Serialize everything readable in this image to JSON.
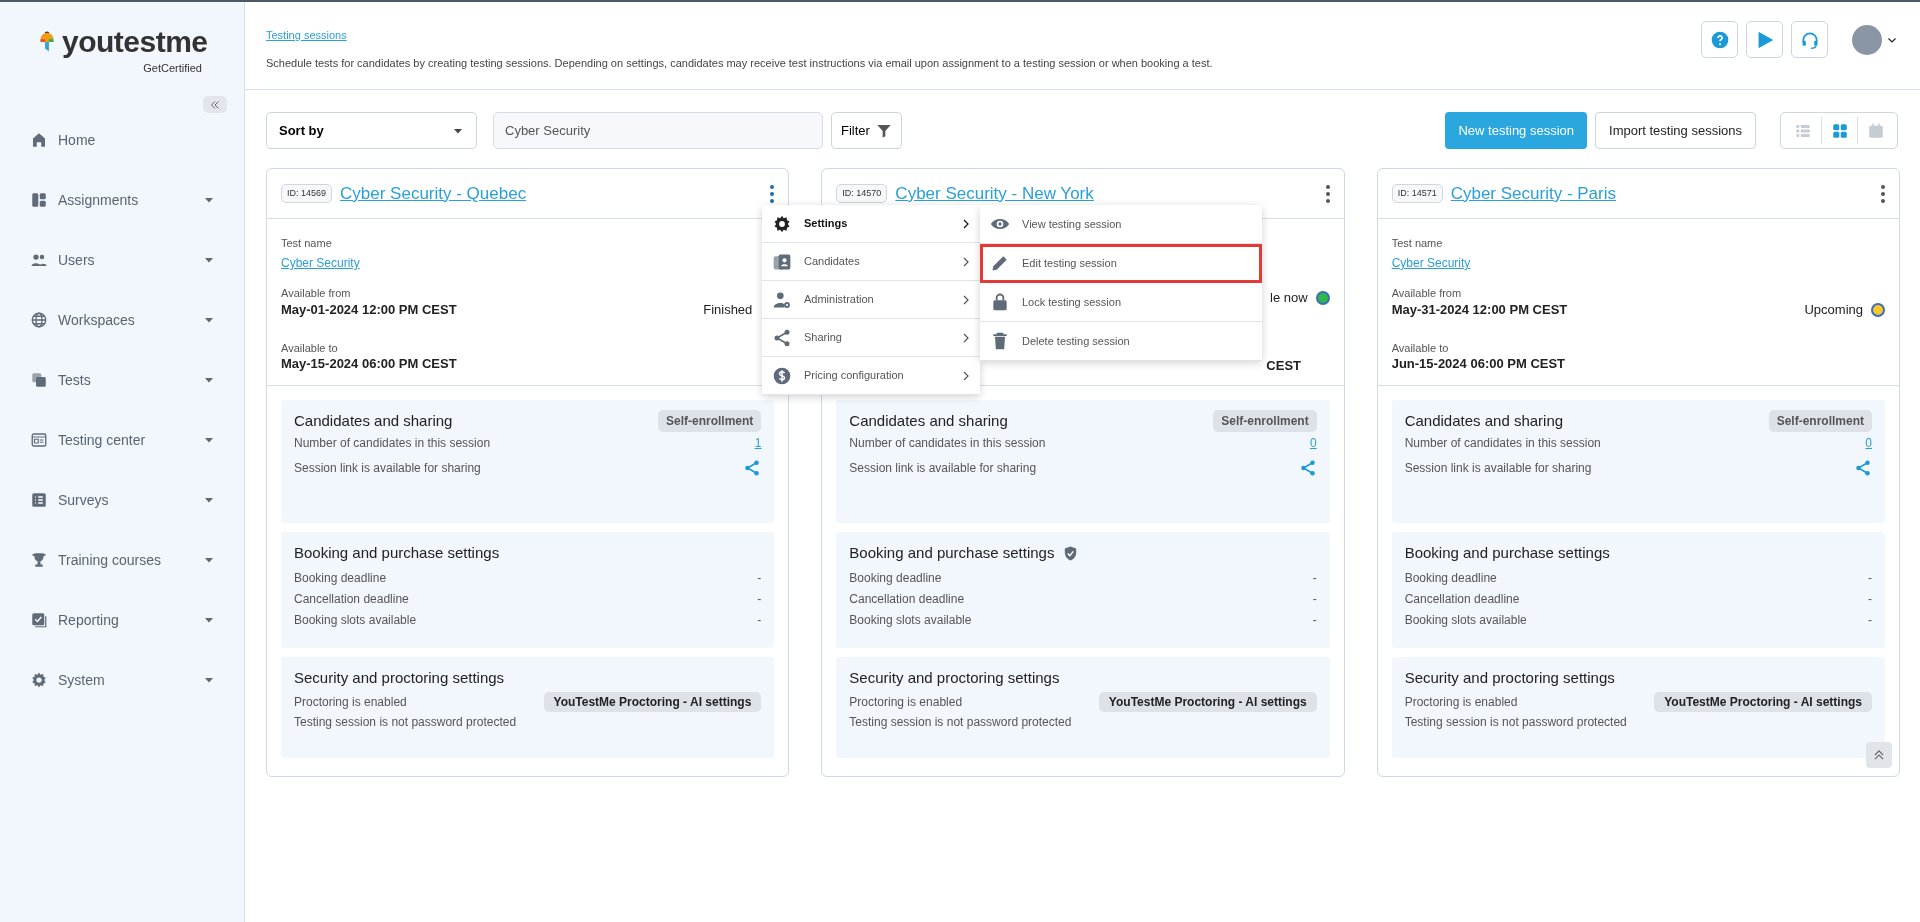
{
  "sidebar": {
    "logo": {
      "name": "youtestme",
      "tagline": "GetCertified"
    },
    "items": [
      {
        "label": "Home",
        "has_submenu": false
      },
      {
        "label": "Assignments",
        "has_submenu": true
      },
      {
        "label": "Users",
        "has_submenu": true
      },
      {
        "label": "Workspaces",
        "has_submenu": true
      },
      {
        "label": "Tests",
        "has_submenu": true
      },
      {
        "label": "Testing center",
        "has_submenu": true
      },
      {
        "label": "Surveys",
        "has_submenu": true
      },
      {
        "label": "Training courses",
        "has_submenu": true
      },
      {
        "label": "Reporting",
        "has_submenu": true
      },
      {
        "label": "System",
        "has_submenu": true
      }
    ]
  },
  "header": {
    "breadcrumb": "Testing sessions",
    "description": "Schedule tests for candidates by creating testing sessions. Depending on settings, candidates may receive test instructions via email upon assignment to a testing session or when booking a test."
  },
  "toolbar": {
    "sort": {
      "label": "Sort by"
    },
    "search": {
      "value": "Cyber Security"
    },
    "filter": "Filter",
    "buttons": [
      {
        "label": "New testing session",
        "kind": "primary"
      },
      {
        "label": "Import testing sessions",
        "kind": "secondary"
      }
    ],
    "views": [
      {
        "kind": "list",
        "selected": false
      },
      {
        "kind": "grid",
        "selected": true
      },
      {
        "kind": "calendar",
        "selected": false
      }
    ]
  },
  "sessions": [
    {
      "id": "ID: 14569",
      "title": "Cyber Security - Quebec",
      "test_label": "Test name",
      "test_name": "Cyber Security",
      "from_label": "Available from",
      "from": "May-01-2024 12:00 PM CEST",
      "status": "Finished",
      "to_label": "Available to",
      "to": "May-15-2024 06:00 PM CEST",
      "candidates": {
        "title": "Candidates and sharing",
        "badge": "Self-enrollment",
        "count_label": "Number of candidates in this session",
        "count": "1",
        "share_label": "Session link is available for sharing"
      },
      "booking": {
        "title": "Booking and purchase settings",
        "verified": false,
        "rows": [
          {
            "label": "Booking deadline",
            "value": "-"
          },
          {
            "label": "Cancellation deadline",
            "value": "-"
          },
          {
            "label": "Booking slots available",
            "value": "-"
          }
        ]
      },
      "security": {
        "title": "Security and proctoring settings",
        "proctoring_label": "Proctoring is enabled",
        "proctoring_badge": "YouTestMe Proctoring - AI settings",
        "password_label": "Testing session is not password protected"
      }
    },
    {
      "id": "ID: 14570",
      "title": "Cyber Security - New York",
      "status": "le now",
      "color": "#2eb84b",
      "to": "CEST",
      "candidates": {
        "title": "Candidates and sharing",
        "badge": "Self-enrollment",
        "count_label": "Number of candidates in this session",
        "count": "0",
        "share_label": "Session link is available for sharing"
      },
      "booking": {
        "title": "Booking and purchase settings",
        "verified": true,
        "rows": [
          {
            "label": "Booking deadline",
            "value": "-"
          },
          {
            "label": "Cancellation deadline",
            "value": "-"
          },
          {
            "label": "Booking slots available",
            "value": "-"
          }
        ]
      },
      "security": {
        "title": "Security and proctoring settings",
        "proctoring_label": "Proctoring is enabled",
        "proctoring_badge": "YouTestMe Proctoring - AI settings",
        "password_label": "Testing session is not password protected"
      }
    },
    {
      "id": "ID: 14571",
      "title": "Cyber Security - Paris",
      "test_label": "Test name",
      "test_name": "Cyber Security",
      "from_label": "Available from",
      "from": "May-31-2024 12:00 PM CEST",
      "status": "Upcoming",
      "color": "#f6c830",
      "to_label": "Available to",
      "to": "Jun-15-2024 06:00 PM CEST",
      "candidates": {
        "title": "Candidates and sharing",
        "badge": "Self-enrollment",
        "count_label": "Number of candidates in this session",
        "count": "0",
        "share_label": "Session link is available for sharing"
      },
      "booking": {
        "title": "Booking and purchase settings",
        "verified": false,
        "rows": [
          {
            "label": "Booking deadline",
            "value": "-"
          },
          {
            "label": "Cancellation deadline",
            "value": "-"
          },
          {
            "label": "Booking slots available",
            "value": "-"
          }
        ]
      },
      "security": {
        "title": "Security and proctoring settings",
        "proctoring_label": "Proctoring is enabled",
        "proctoring_badge": "YouTestMe Proctoring - AI settings",
        "password_label": "Testing session is not password protected"
      }
    }
  ],
  "context_menu": {
    "items": [
      {
        "label": "Settings",
        "selected": true
      },
      {
        "label": "Candidates",
        "selected": false
      },
      {
        "label": "Administration",
        "selected": false
      },
      {
        "label": "Sharing",
        "selected": false
      },
      {
        "label": "Pricing configuration",
        "selected": false
      }
    ],
    "submenu": [
      {
        "label": "View testing session",
        "highlighted": false
      },
      {
        "label": "Edit testing session",
        "highlighted": true
      },
      {
        "label": "Lock testing session",
        "highlighted": false
      },
      {
        "label": "Delete testing session",
        "highlighted": false
      }
    ]
  }
}
